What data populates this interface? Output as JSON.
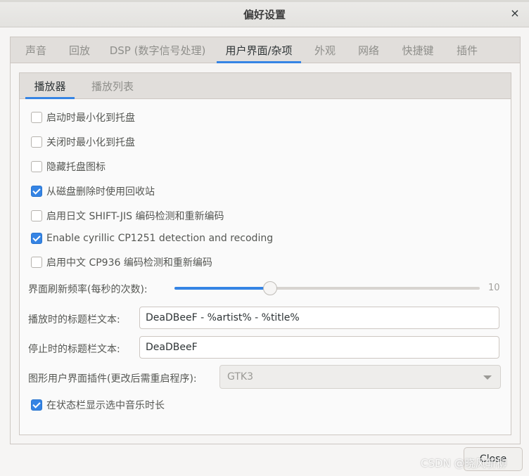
{
  "window": {
    "title": "偏好设置",
    "close_glyph": "×"
  },
  "tabs": [
    {
      "label": "声音"
    },
    {
      "label": "回放"
    },
    {
      "label": "DSP (数字信号处理)"
    },
    {
      "label": "用户界面/杂项"
    },
    {
      "label": "外观"
    },
    {
      "label": "网络"
    },
    {
      "label": "快捷键"
    },
    {
      "label": "插件"
    }
  ],
  "active_tab": "用户界面/杂项",
  "inner_tabs": [
    {
      "label": "播放器"
    },
    {
      "label": "播放列表"
    }
  ],
  "active_inner_tab": "播放器",
  "options": [
    {
      "label": "启动时最小化到托盘",
      "checked": false
    },
    {
      "label": "关闭时最小化到托盘",
      "checked": false
    },
    {
      "label": "隐藏托盘图标",
      "checked": false
    },
    {
      "label": "从磁盘删除时使用回收站",
      "checked": true
    },
    {
      "label": "启用日文 SHIFT-JIS 编码检测和重新编码",
      "checked": false
    },
    {
      "label": "Enable cyrillic CP1251 detection and recoding",
      "checked": true
    },
    {
      "label": "启用中文 CP936 编码检测和重新编码",
      "checked": false
    }
  ],
  "refresh_rate": {
    "label": "界面刷新频率(每秒的次数):",
    "value": "10",
    "fraction": 0.31
  },
  "playing_title": {
    "label": "播放时的标题栏文本:",
    "value": "DeaDBeeF - %artist% - %title%"
  },
  "stopped_title": {
    "label": "停止时的标题栏文本:",
    "value": "DeaDBeeF"
  },
  "gui_plugin": {
    "label": "图形用户界面插件(更改后需重启程序):",
    "value": "GTK3"
  },
  "status_bar_option": {
    "label": "在状态栏显示选中音乐时长",
    "checked": true
  },
  "footer": {
    "close_label": "Close",
    "watermark": "CSDN @晓风斩柳"
  },
  "colors": {
    "accent": "#3584e4",
    "text": "#2e3436",
    "muted_text": "#8f8f8b"
  }
}
